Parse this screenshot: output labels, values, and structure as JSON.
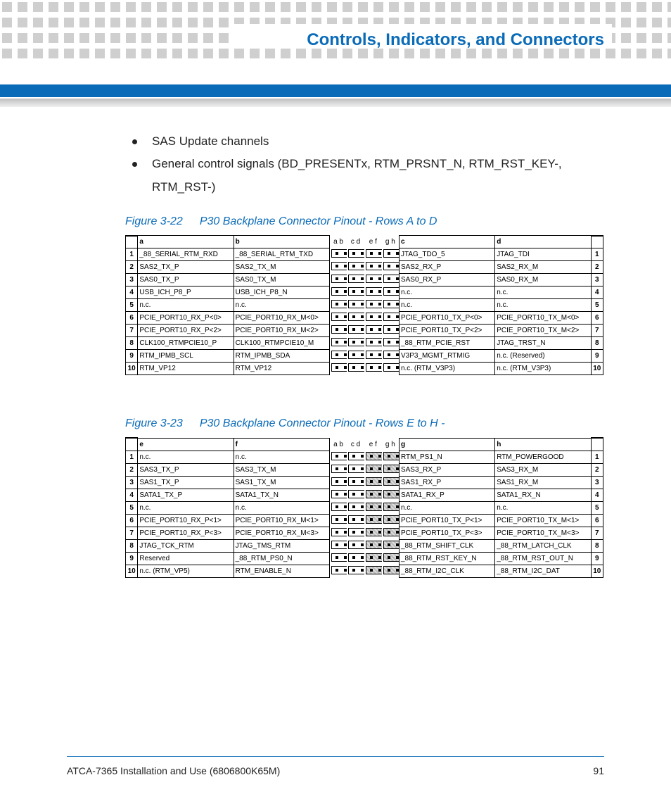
{
  "header": {
    "title": "Controls, Indicators, and Connectors"
  },
  "bullets": [
    "SAS Update channels",
    "General control signals (BD_PRESENTx, RTM_PRSNT_N, RTM_RST_KEY-, RTM_RST-)"
  ],
  "fig1": {
    "label": "Figure 3-22",
    "title": "P30 Backplane Connector Pinout - Rows A to D",
    "colheads": {
      "left1": "a",
      "left2": "b",
      "p1": "a b",
      "p2": "c d",
      "p3": "e f",
      "p4": "g h",
      "right1": "c",
      "right2": "d"
    },
    "rows": [
      {
        "n": "1",
        "a": "_88_SERIAL_RTM_RXD",
        "b": "_88_SERIAL_RTM_TXD",
        "c": "JTAG_TDO_5",
        "d": "JTAG_TDI"
      },
      {
        "n": "2",
        "a": "SAS2_TX_P",
        "b": "SAS2_TX_M",
        "c": "SAS2_RX_P",
        "d": "SAS2_RX_M"
      },
      {
        "n": "3",
        "a": "SAS0_TX_P",
        "b": "SAS0_TX_M",
        "c": "SAS0_RX_P",
        "d": "SAS0_RX_M"
      },
      {
        "n": "4",
        "a": "USB_ICH_P8_P",
        "b": "USB_ICH_P8_N",
        "c": "n.c.",
        "d": "n.c."
      },
      {
        "n": "5",
        "a": "n.c.",
        "b": "n.c.",
        "c": "n.c.",
        "d": "n.c."
      },
      {
        "n": "6",
        "a": "PCIE_PORT10_RX_P<0>",
        "b": "PCIE_PORT10_RX_M<0>",
        "c": "PCIE_PORT10_TX_P<0>",
        "d": "PCIE_PORT10_TX_M<0>"
      },
      {
        "n": "7",
        "a": "PCIE_PORT10_RX_P<2>",
        "b": "PCIE_PORT10_RX_M<2>",
        "c": "PCIE_PORT10_TX_P<2>",
        "d": "PCIE_PORT10_TX_M<2>"
      },
      {
        "n": "8",
        "a": "CLK100_RTMPCIE10_P",
        "b": "CLK100_RTMPCIE10_M",
        "c": "_88_RTM_PCIE_RST",
        "d": "JTAG_TRST_N"
      },
      {
        "n": "9",
        "a": "RTM_IPMB_SCL",
        "b": "RTM_IPMB_SDA",
        "c": "V3P3_MGMT_RTMIG",
        "d": "n.c. (Reserved)"
      },
      {
        "n": "10",
        "a": "RTM_VP12",
        "b": "RTM_VP12",
        "c": "n.c. (RTM_V3P3)",
        "d": "n.c. (RTM_V3P3)"
      }
    ]
  },
  "fig2": {
    "label": "Figure 3-23",
    "title": "P30 Backplane Connector Pinout - Rows E to H -",
    "colheads": {
      "left1": "e",
      "left2": "f",
      "p1": "a b",
      "p2": "c d",
      "p3": "e f",
      "p4": "g h",
      "right1": "g",
      "right2": "h"
    },
    "rows": [
      {
        "n": "1",
        "a": "n.c.",
        "b": "n.c.",
        "c": "RTM_PS1_N",
        "d": "RTM_POWERGOOD"
      },
      {
        "n": "2",
        "a": "SAS3_TX_P",
        "b": "SAS3_TX_M",
        "c": "SAS3_RX_P",
        "d": "SAS3_RX_M"
      },
      {
        "n": "3",
        "a": "SAS1_TX_P",
        "b": "SAS1_TX_M",
        "c": "SAS1_RX_P",
        "d": "SAS1_RX_M"
      },
      {
        "n": "4",
        "a": "SATA1_TX_P",
        "b": "SATA1_TX_N",
        "c": "SATA1_RX_P",
        "d": "SATA1_RX_N"
      },
      {
        "n": "5",
        "a": "n.c.",
        "b": "n.c.",
        "c": "n.c.",
        "d": "n.c."
      },
      {
        "n": "6",
        "a": "PCIE_PORT10_RX_P<1>",
        "b": "PCIE_PORT10_RX_M<1>",
        "c": "PCIE_PORT10_TX_P<1>",
        "d": "PCIE_PORT10_TX_M<1>"
      },
      {
        "n": "7",
        "a": "PCIE_PORT10_RX_P<3>",
        "b": "PCIE_PORT10_RX_M<3>",
        "c": "PCIE_PORT10_TX_P<3>",
        "d": "PCIE_PORT10_TX_M<3>"
      },
      {
        "n": "8",
        "a": "JTAG_TCK_RTM",
        "b": "JTAG_TMS_RTM",
        "c": "_88_RTM_SHIFT_CLK",
        "d": "_88_RTM_LATCH_CLK"
      },
      {
        "n": "9",
        "a": "Reserved",
        "b": "_88_RTM_PS0_N",
        "c": "_88_RTM_RST_KEY_N",
        "d": "_88_RTM_RST_OUT_N"
      },
      {
        "n": "10",
        "a": "n.c. (RTM_VP5)",
        "b": "RTM_ENABLE_N",
        "c": "_88_RTM_I2C_CLK",
        "d": "_88_RTM_I2C_DAT"
      }
    ]
  },
  "footer": {
    "left": "ATCA-7365 Installation and Use (6806800K65M)",
    "right": "91"
  }
}
